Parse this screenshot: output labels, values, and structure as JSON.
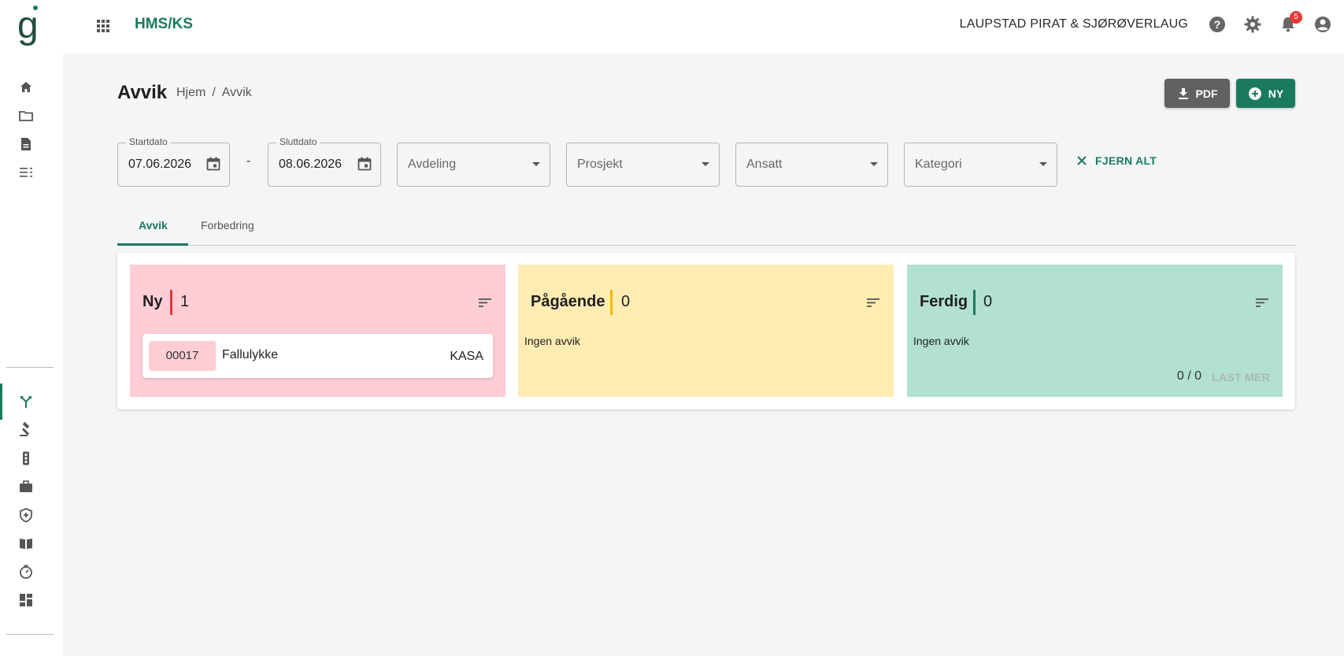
{
  "header": {
    "app_title": "HMS/KS",
    "org_name": "LAUPSTAD PIRAT & SJØRØVERLAUG",
    "notification_count": "5"
  },
  "page": {
    "title": "Avvik",
    "breadcrumb": [
      "Hjem",
      "/",
      "Avvik"
    ],
    "pdf_label": "PDF",
    "new_label": "NY"
  },
  "filters": {
    "start_label": "Startdato",
    "start_value": "07.06.2026",
    "separator": "-",
    "end_label": "Sluttdato",
    "end_value": "08.06.2026",
    "department": "Avdeling",
    "project": "Prosjekt",
    "employee": "Ansatt",
    "category": "Kategori",
    "clear_all": "FJERN ALT"
  },
  "tabs": [
    {
      "label": "Avvik",
      "active": true
    },
    {
      "label": "Forbedring",
      "active": false
    }
  ],
  "columns": [
    {
      "title": "Ny",
      "count": "1",
      "accent": "#e53935"
    },
    {
      "title": "Pågående",
      "count": "0",
      "accent": "#f5b800",
      "empty_text": "Ingen avvik"
    },
    {
      "title": "Ferdig",
      "count": "0",
      "accent": "#1a7a5e",
      "empty_text": "Ingen avvik",
      "pager": "0 / 0",
      "load_more": "LAST MER"
    }
  ],
  "cards": [
    {
      "id": "00017",
      "title": "Fallulykke",
      "code": "KASA"
    }
  ],
  "colors": {
    "brand": "#1a7a5e",
    "col_ny_bg": "#ffcdd5",
    "col_pagaende_bg": "#ffecb3",
    "col_ferdig_bg": "#b2e0d3"
  },
  "sidebar_icons": [
    "home-icon",
    "folder-icon",
    "document-icon",
    "checklist-icon",
    "deviation-icon",
    "gavel-icon",
    "traffic-light-icon",
    "briefcase-icon",
    "shield-icon",
    "book-icon",
    "timer-icon",
    "dashboard-icon"
  ]
}
